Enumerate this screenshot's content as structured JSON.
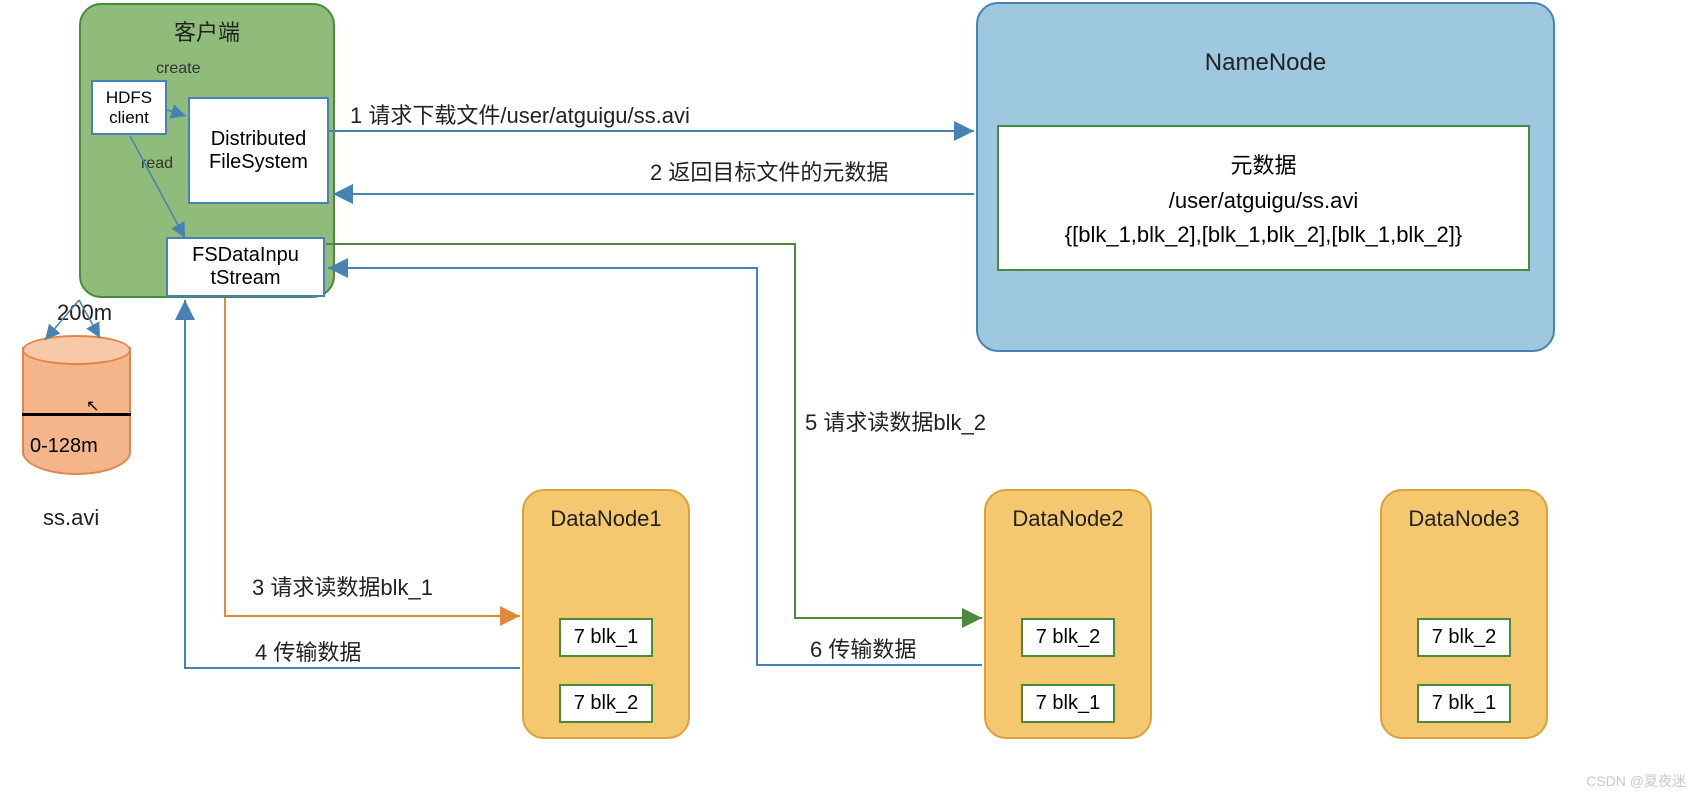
{
  "client": {
    "title": "客户端",
    "create_label": "create",
    "read_label": "read",
    "hdfs_client": "HDFS\nclient",
    "dfs": "Distributed\nFileSystem",
    "fsdis": "FSDataInpu\ntStream",
    "size_label": "200m"
  },
  "namenode": {
    "title": "NameNode",
    "meta_title": "元数据",
    "meta_path": "/user/atguigu/ss.avi",
    "meta_blocks": "{[blk_1,blk_2],[blk_1,blk_2],[blk_1,blk_2]}"
  },
  "disk": {
    "range": "0-128m",
    "file": "ss.avi"
  },
  "arrows": {
    "a1": "1 请求下载文件/user/atguigu/ss.avi",
    "a2": "2 返回目标文件的元数据",
    "a3": "3 请求读数据blk_1",
    "a4": "4 传输数据",
    "a5": "5 请求读数据blk_2",
    "a6": "6 传输数据"
  },
  "datanodes": [
    {
      "title": "DataNode1",
      "blk_a": "7 blk_1",
      "blk_b": "7 blk_2"
    },
    {
      "title": "DataNode2",
      "blk_a": "7 blk_2",
      "blk_b": "7 blk_1"
    },
    {
      "title": "DataNode3",
      "blk_a": "7 blk_2",
      "blk_b": "7 blk_1"
    }
  ],
  "watermark": "CSDN @夏夜迷"
}
